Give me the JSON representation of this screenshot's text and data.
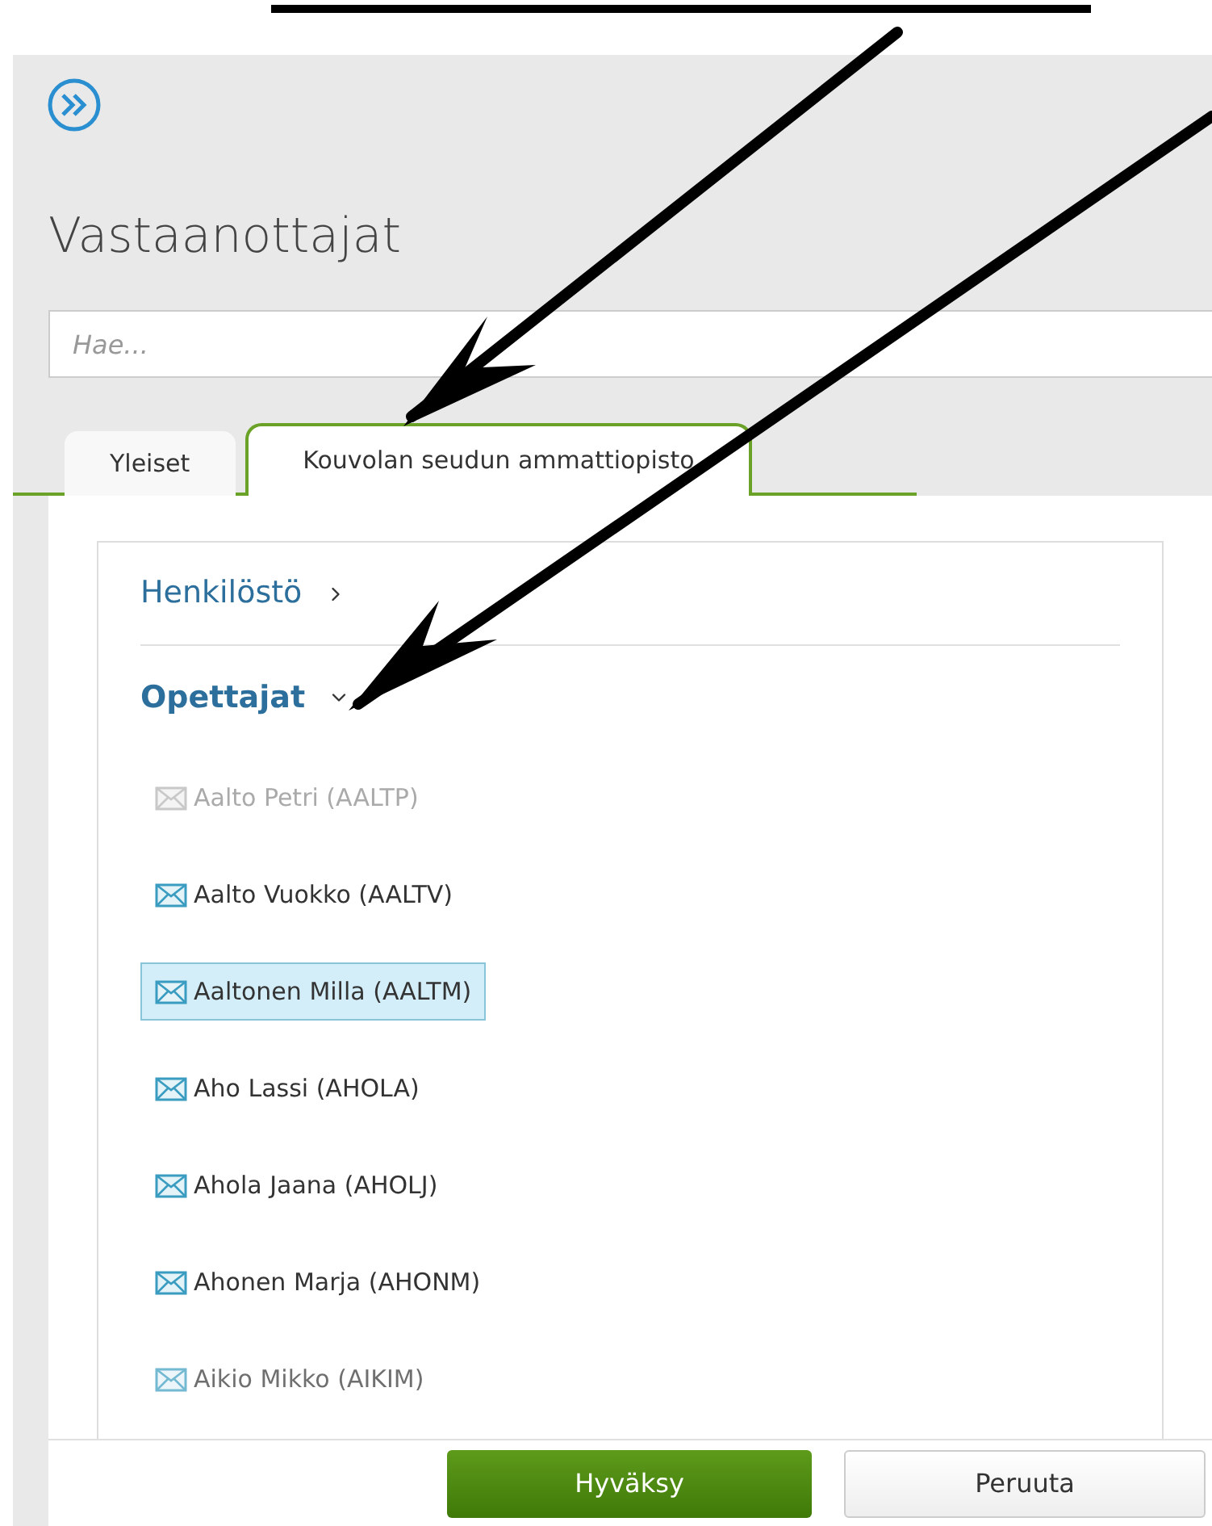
{
  "title": "Vastaanottajat",
  "search": {
    "placeholder": "Hae..."
  },
  "tabs": [
    {
      "label": "Yleiset",
      "selected": false
    },
    {
      "label": "Kouvolan seudun ammattiopisto",
      "selected": true
    }
  ],
  "groups": [
    {
      "label": "Henkilöstö",
      "expanded": false
    },
    {
      "label": "Opettajat",
      "expanded": true
    }
  ],
  "recipients": [
    {
      "label": "Aalto Petri (AALTP)",
      "disabled": true,
      "selected": false
    },
    {
      "label": "Aalto Vuokko (AALTV)",
      "disabled": false,
      "selected": false
    },
    {
      "label": "Aaltonen Milla (AALTM)",
      "disabled": false,
      "selected": true
    },
    {
      "label": "Aho Lassi (AHOLA)",
      "disabled": false,
      "selected": false
    },
    {
      "label": "Ahola Jaana (AHOLJ)",
      "disabled": false,
      "selected": false
    },
    {
      "label": "Ahonen Marja (AHONM)",
      "disabled": false,
      "selected": false
    },
    {
      "label": "Aikio Mikko (AIKIM)",
      "disabled": false,
      "selected": false
    }
  ],
  "buttons": [
    {
      "label": "Hyväksy",
      "kind": "primary"
    },
    {
      "label": "Peruuta",
      "kind": "secondary"
    }
  ]
}
